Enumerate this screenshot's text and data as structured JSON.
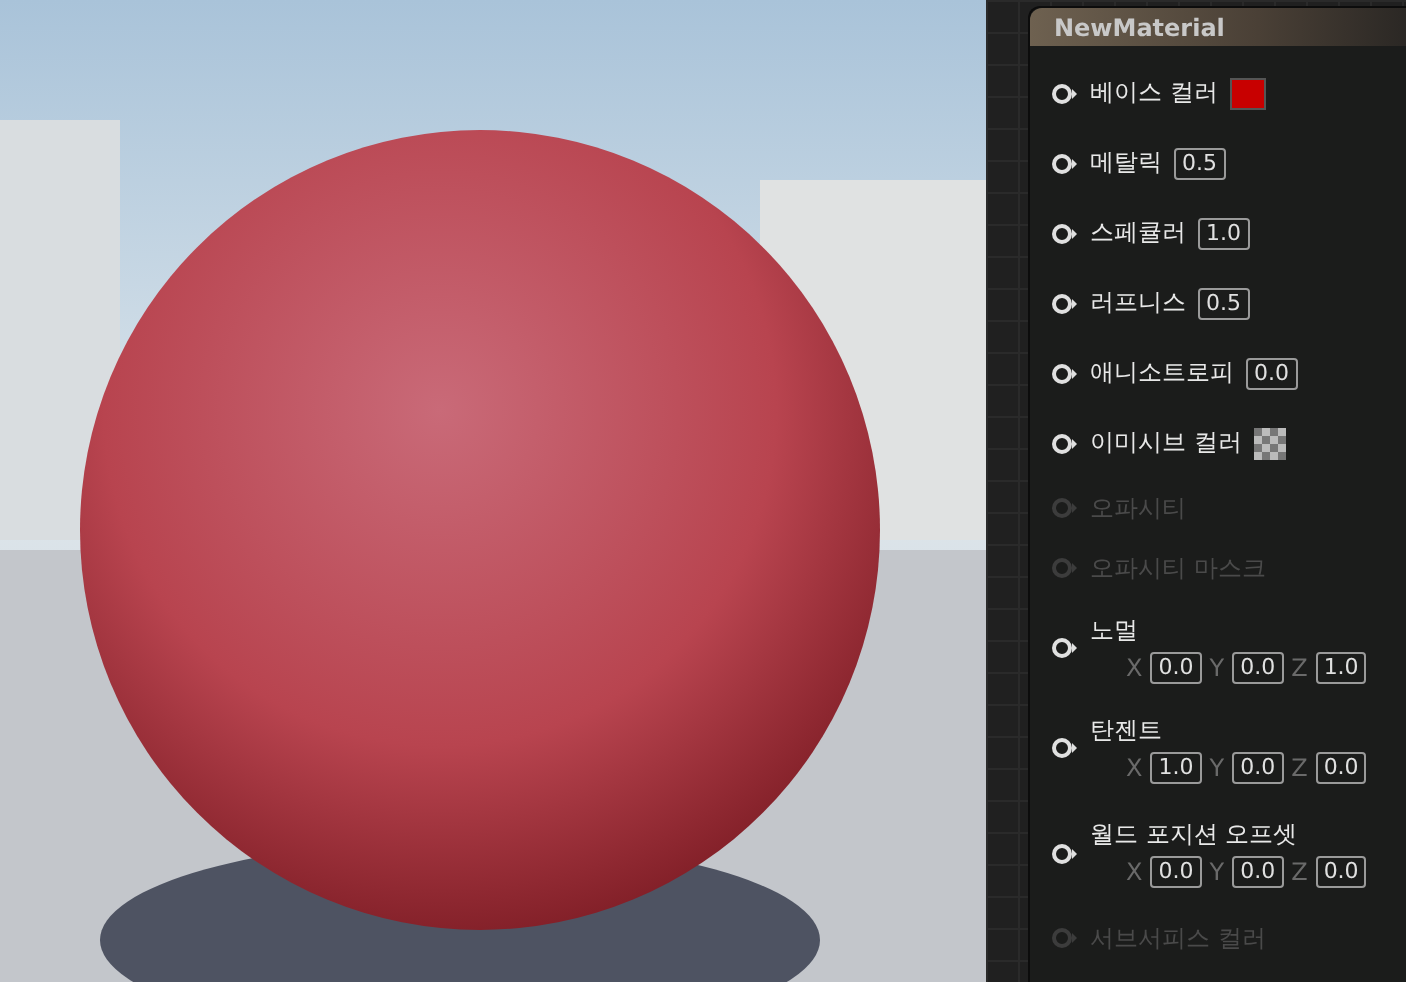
{
  "node": {
    "title": "NewMaterial"
  },
  "pins": [
    {
      "kind": "color",
      "label": "베이스 컬러",
      "enabled": true,
      "color": "#c80000"
    },
    {
      "kind": "scalar",
      "label": "메탈릭",
      "enabled": true,
      "value": "0.5"
    },
    {
      "kind": "scalar",
      "label": "스페큘러",
      "enabled": true,
      "value": "1.0"
    },
    {
      "kind": "scalar",
      "label": "러프니스",
      "enabled": true,
      "value": "0.5"
    },
    {
      "kind": "scalar",
      "label": "애니소트로피",
      "enabled": true,
      "value": "0.0"
    },
    {
      "kind": "texture",
      "label": "이미시브 컬러",
      "enabled": true
    },
    {
      "kind": "plain",
      "label": "오파시티",
      "enabled": false
    },
    {
      "kind": "plain",
      "label": "오파시티 마스크",
      "enabled": false
    },
    {
      "kind": "vector",
      "label": "노멀",
      "enabled": true,
      "components": [
        {
          "axis": "X",
          "value": "0.0"
        },
        {
          "axis": "Y",
          "value": "0.0"
        },
        {
          "axis": "Z",
          "value": "1.0"
        }
      ]
    },
    {
      "kind": "vector",
      "label": "탄젠트",
      "enabled": true,
      "components": [
        {
          "axis": "X",
          "value": "1.0"
        },
        {
          "axis": "Y",
          "value": "0.0"
        },
        {
          "axis": "Z",
          "value": "0.0"
        }
      ]
    },
    {
      "kind": "vector",
      "label": "월드 포지션 오프셋",
      "enabled": true,
      "components": [
        {
          "axis": "X",
          "value": "0.0"
        },
        {
          "axis": "Y",
          "value": "0.0"
        },
        {
          "axis": "Z",
          "value": "0.0"
        }
      ]
    },
    {
      "kind": "plain",
      "label": "서브서피스 컬러",
      "enabled": false
    }
  ]
}
